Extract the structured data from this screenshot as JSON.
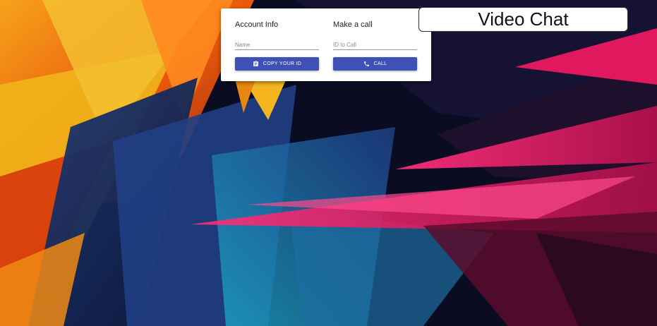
{
  "app": {
    "title": "Video Chat"
  },
  "account": {
    "heading": "Account Info",
    "name_placeholder": "Name",
    "copy_button_label": "COPY YOUR ID",
    "copy_icon": "clipboard-icon"
  },
  "call": {
    "heading": "Make a call",
    "id_placeholder": "ID to Call",
    "call_button_label": "CALL",
    "call_icon": "phone-icon"
  },
  "colors": {
    "primary_button": "#3f51b5",
    "panel": "#ffffff"
  }
}
